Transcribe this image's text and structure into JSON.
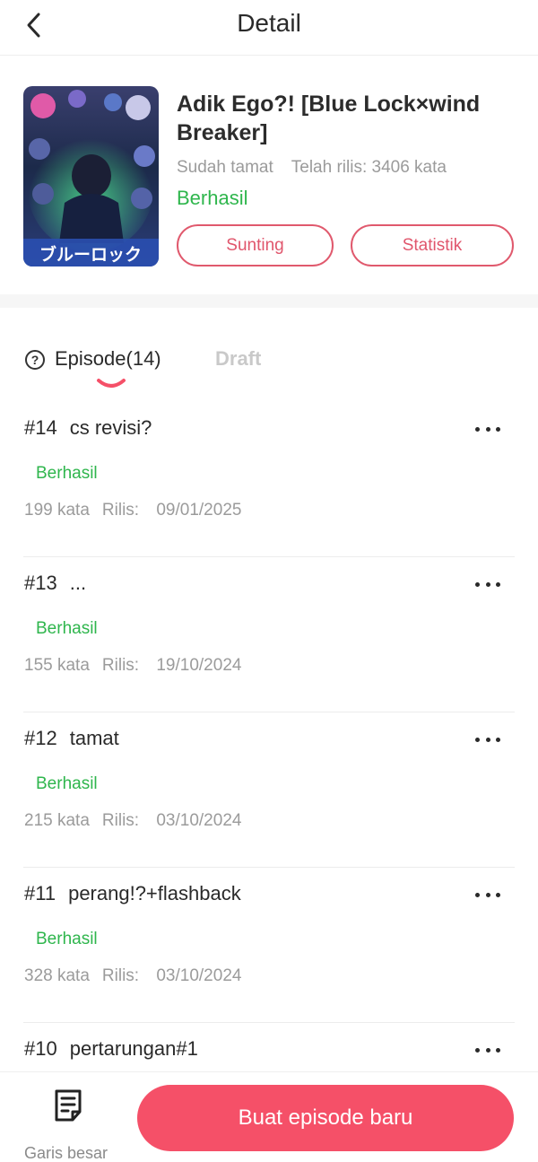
{
  "header": {
    "title": "Detail",
    "back_icon": "chevron-left-icon"
  },
  "book": {
    "title": "Adik Ego?! [Blue Lock×wind Breaker]",
    "completion": "Sudah tamat",
    "released": "Telah rilis: 3406 kata",
    "status": "Berhasil",
    "edit_label": "Sunting",
    "stats_label": "Statistik",
    "cover_art_text": "ブルーロック"
  },
  "tabs": {
    "help_icon": "question-circle-icon",
    "help_glyph": "?",
    "episode_label": "Episode(14)",
    "draft_label": "Draft"
  },
  "episodes": [
    {
      "num": "#14",
      "title": "cs revisi?",
      "status": "Berhasil",
      "words": "199 kata",
      "release_label": "Rilis:",
      "date": "09/01/2025"
    },
    {
      "num": "#13",
      "title": "...",
      "status": "Berhasil",
      "words": "155 kata",
      "release_label": "Rilis:",
      "date": "19/10/2024"
    },
    {
      "num": "#12",
      "title": "tamat",
      "status": "Berhasil",
      "words": "215 kata",
      "release_label": "Rilis:",
      "date": "03/10/2024"
    },
    {
      "num": "#11",
      "title": "perang!?+flashback",
      "status": "Berhasil",
      "words": "328 kata",
      "release_label": "Rilis:",
      "date": "03/10/2024"
    },
    {
      "num": "#10",
      "title": "pertarungan#1"
    }
  ],
  "bottom": {
    "outline_label": "Garis besar",
    "outline_icon": "document-lines-icon",
    "new_episode_label": "Buat episode baru"
  },
  "colors": {
    "accent": "#f55068",
    "pill_border": "#e0596d",
    "success": "#2fb64d",
    "muted": "#9b9b9b"
  }
}
